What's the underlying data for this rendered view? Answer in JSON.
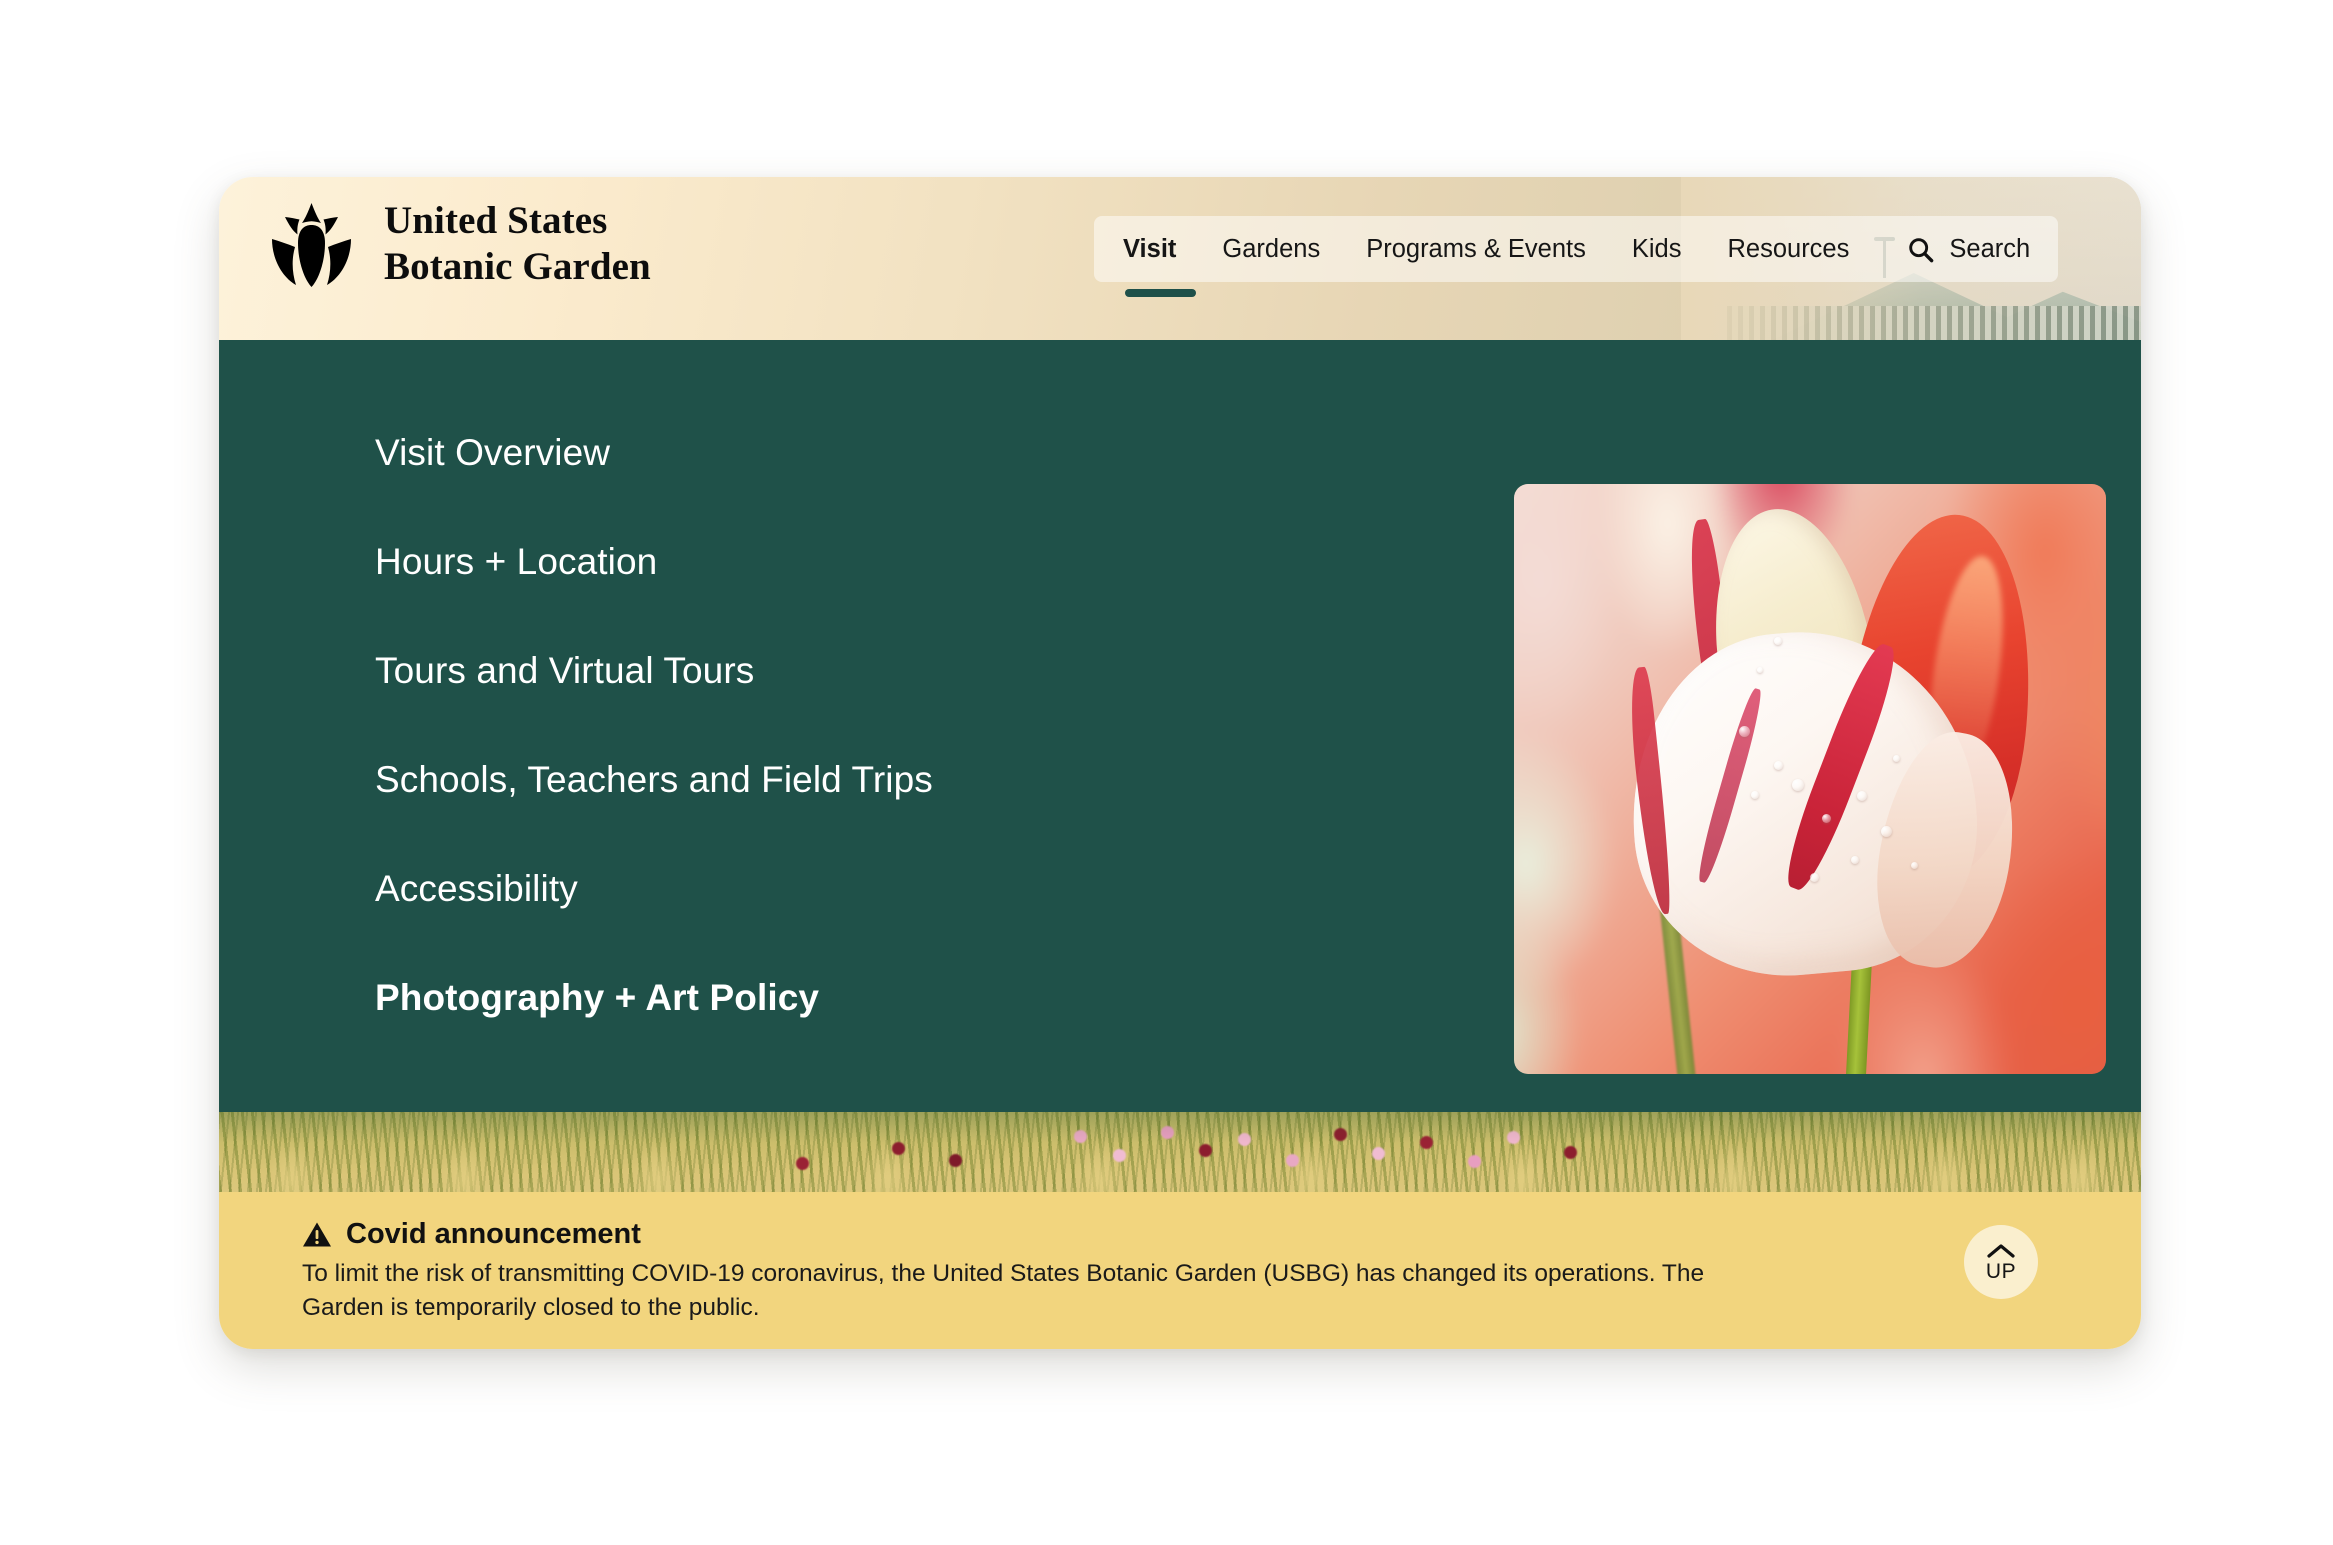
{
  "header": {
    "brand": {
      "logo_icon": "tulip-logo-icon",
      "line1": "United States",
      "line2": "Botanic Garden"
    },
    "nav": [
      {
        "label": "Visit",
        "active": true
      },
      {
        "label": "Gardens",
        "active": false
      },
      {
        "label": "Programs & Events",
        "active": false
      },
      {
        "label": "Kids",
        "active": false
      },
      {
        "label": "Resources",
        "active": false
      }
    ],
    "search": {
      "icon": "search-icon",
      "label": "Search"
    }
  },
  "mega_menu": {
    "items": [
      {
        "label": "Visit Overview",
        "current": false
      },
      {
        "label": "Hours + Location",
        "current": false
      },
      {
        "label": "Tours and Virtual Tours",
        "current": false
      },
      {
        "label": "Schools, Teachers and Field Trips",
        "current": false
      },
      {
        "label": "Accessibility",
        "current": false
      },
      {
        "label": "Photography + Art Policy",
        "current": true
      }
    ],
    "feature_image_alt": "Close-up of a red and white striped tulip with water droplets"
  },
  "meadow_band": {
    "image_alt": "Prairie grasses and pink wildflowers in a garden bed"
  },
  "scroll_top": {
    "icon": "chevron-up-icon",
    "label": "UP"
  },
  "covid_banner": {
    "icon": "warning-triangle-icon",
    "title": "Covid announcement",
    "body": "To limit the risk of transmitting COVID-19 coronavirus, the United States Botanic Garden (USBG) has changed its operations. The Garden is temporarily closed to the public."
  },
  "colors": {
    "green": "#1F5149",
    "banner_yellow": "#F2D57E",
    "header_cream": "#FBEDD0",
    "header_tan": "#D9CEB2"
  }
}
